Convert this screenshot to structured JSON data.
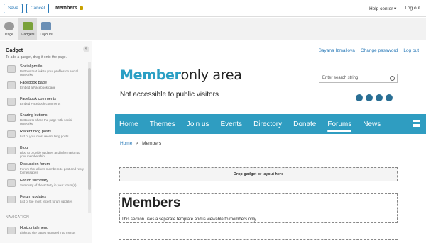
{
  "topbar": {
    "save_label": "Save",
    "cancel_label": "Cancel",
    "title": "Members",
    "help_label": "Help center ▾",
    "user_label": "Log out"
  },
  "toolbar": {
    "tools": [
      {
        "label": "Page"
      },
      {
        "label": "Gadgets"
      },
      {
        "label": "Layouts"
      }
    ]
  },
  "sidebar": {
    "title": "Gadget",
    "subtitle": "To add a gadget, drag it onto the page.",
    "collapse_glyph": "«",
    "gadgets": [
      {
        "name": "Social profile",
        "desc": "Buttons that link to your profiles on social networks"
      },
      {
        "name": "Facebook page",
        "desc": "Embed a Facebook page"
      },
      {
        "name": "Facebook comments",
        "desc": "Embed Facebook comments"
      },
      {
        "name": "Sharing buttons",
        "desc": "Buttons to share the page with social networks"
      },
      {
        "name": "Recent blog posts",
        "desc": "List of your most recent blog posts"
      },
      {
        "name": "Blog",
        "desc": "Blog to provide updates and information to your membership"
      },
      {
        "name": "Discussion forum",
        "desc": "Forum that allows members to post and reply to messages"
      },
      {
        "name": "Forum summary",
        "desc": "Summary of the activity in your forum(s)"
      },
      {
        "name": "Forum updates",
        "desc": "List of the most recent forum updates"
      }
    ],
    "nav_section": "NAVIGATION",
    "nav_item": {
      "name": "Horizontal menu",
      "desc": "Links to site pages grouped into menus"
    }
  },
  "site": {
    "user_links": [
      "Sayana Izmailova",
      "Change password",
      "Log out"
    ],
    "title_accent": "Member",
    "title_rest": "only area",
    "tagline": "Not accessible to public visitors",
    "search_placeholder": "Enter search string",
    "nav": [
      "Home",
      "Themes",
      "Join us",
      "Events",
      "Directory",
      "Donate",
      "Forums",
      "News"
    ],
    "active_nav": "Forums",
    "breadcrumb": {
      "home": "Home",
      "sep": ">",
      "current": "Members"
    },
    "dropzone_label": "Drop gadget or layout here",
    "section_title": "Members",
    "section_text": "This section uses a separate template and is viewable to members only."
  }
}
